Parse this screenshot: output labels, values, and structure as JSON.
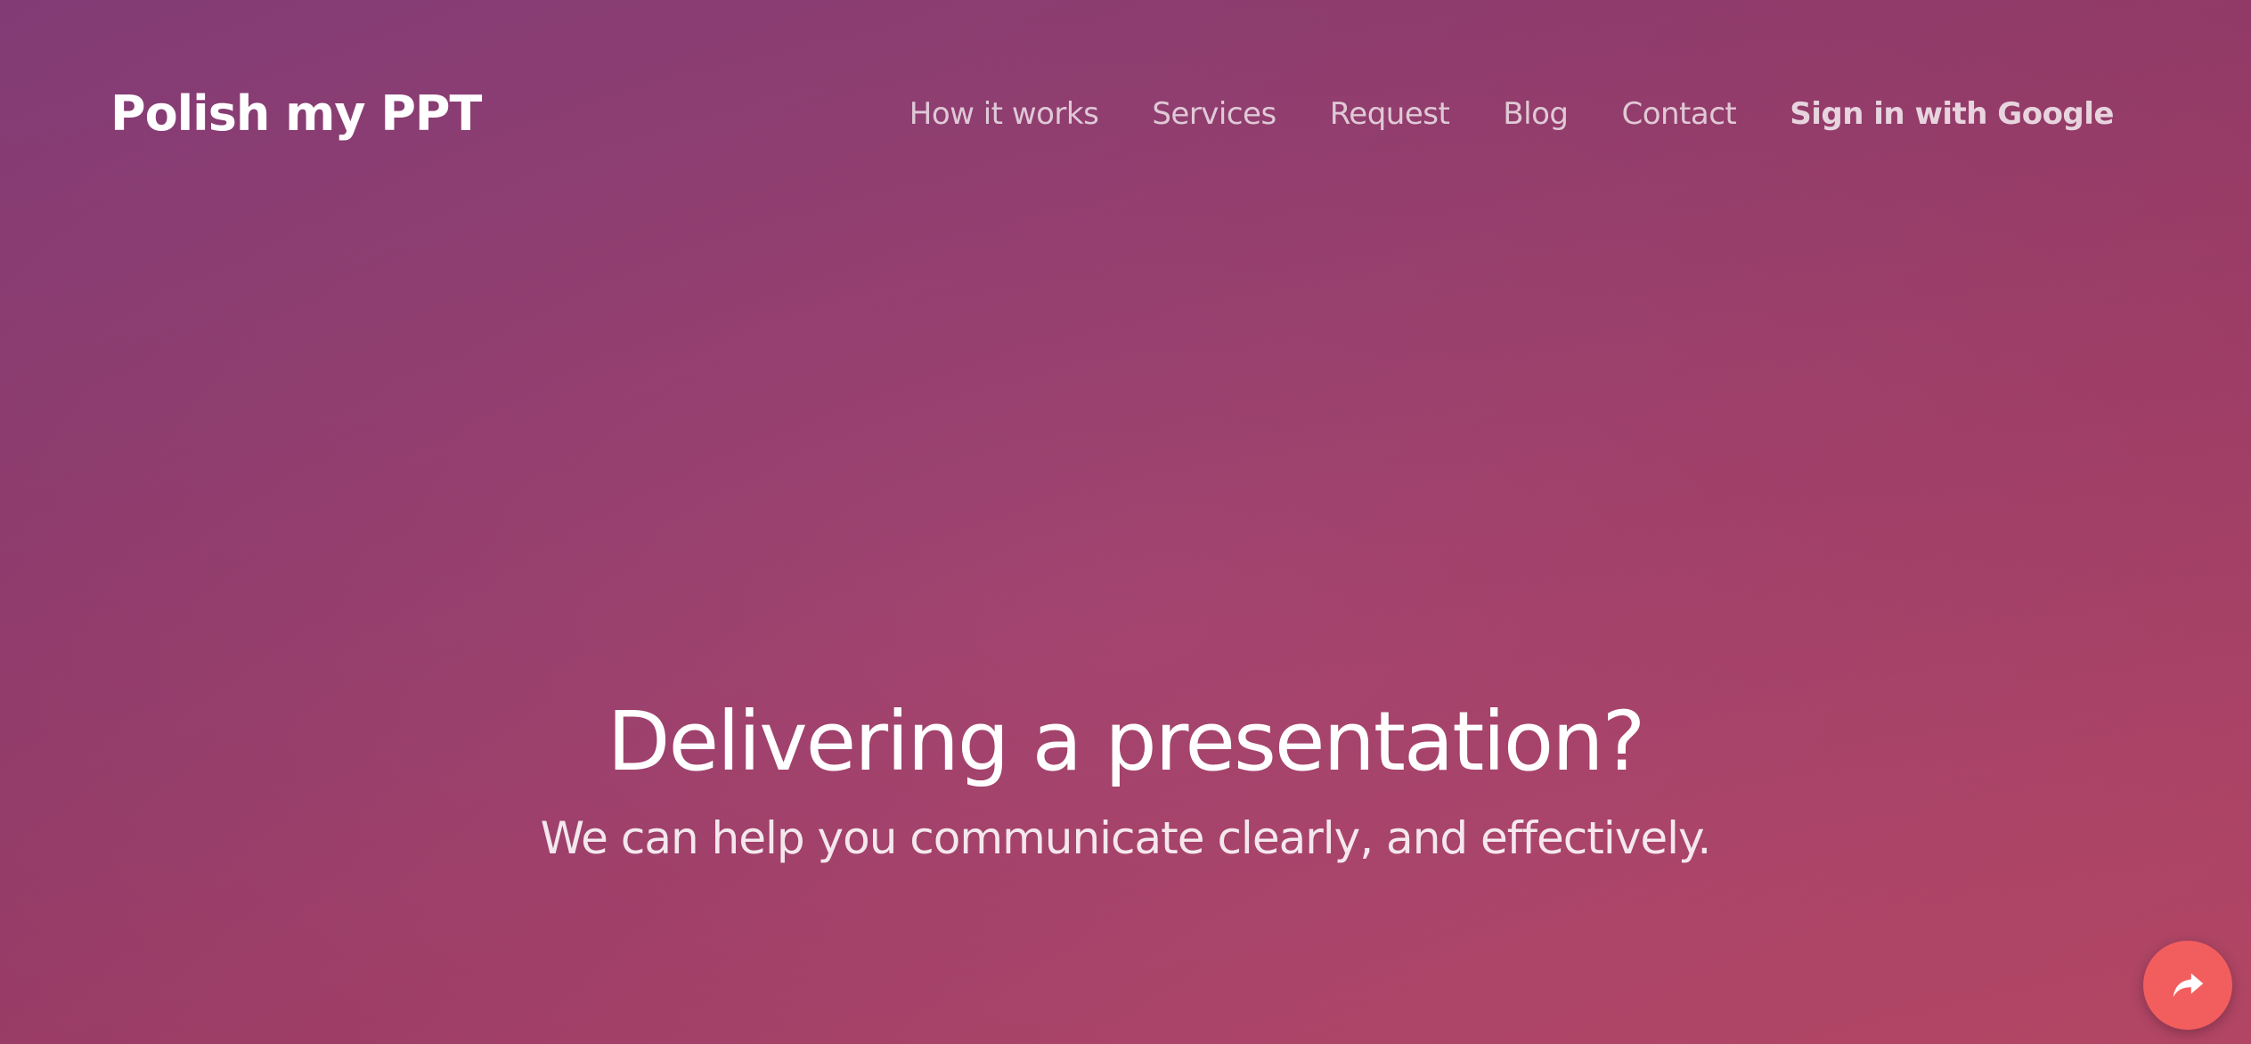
{
  "header": {
    "brand": "Polish my PPT",
    "nav": [
      {
        "label": "How it works"
      },
      {
        "label": "Services"
      },
      {
        "label": "Request"
      },
      {
        "label": "Blog"
      },
      {
        "label": "Contact"
      },
      {
        "label": "Sign in with Google"
      }
    ]
  },
  "hero": {
    "title": "Delivering a presentation?",
    "subtitle": "We can help you communicate clearly, and effectively."
  },
  "fab": {
    "icon": "share-arrow-icon"
  },
  "colors": {
    "background_start": "#8a3f7c",
    "background_end": "#bb4868",
    "fab": "#f25e5e",
    "text": "#ffffff"
  }
}
